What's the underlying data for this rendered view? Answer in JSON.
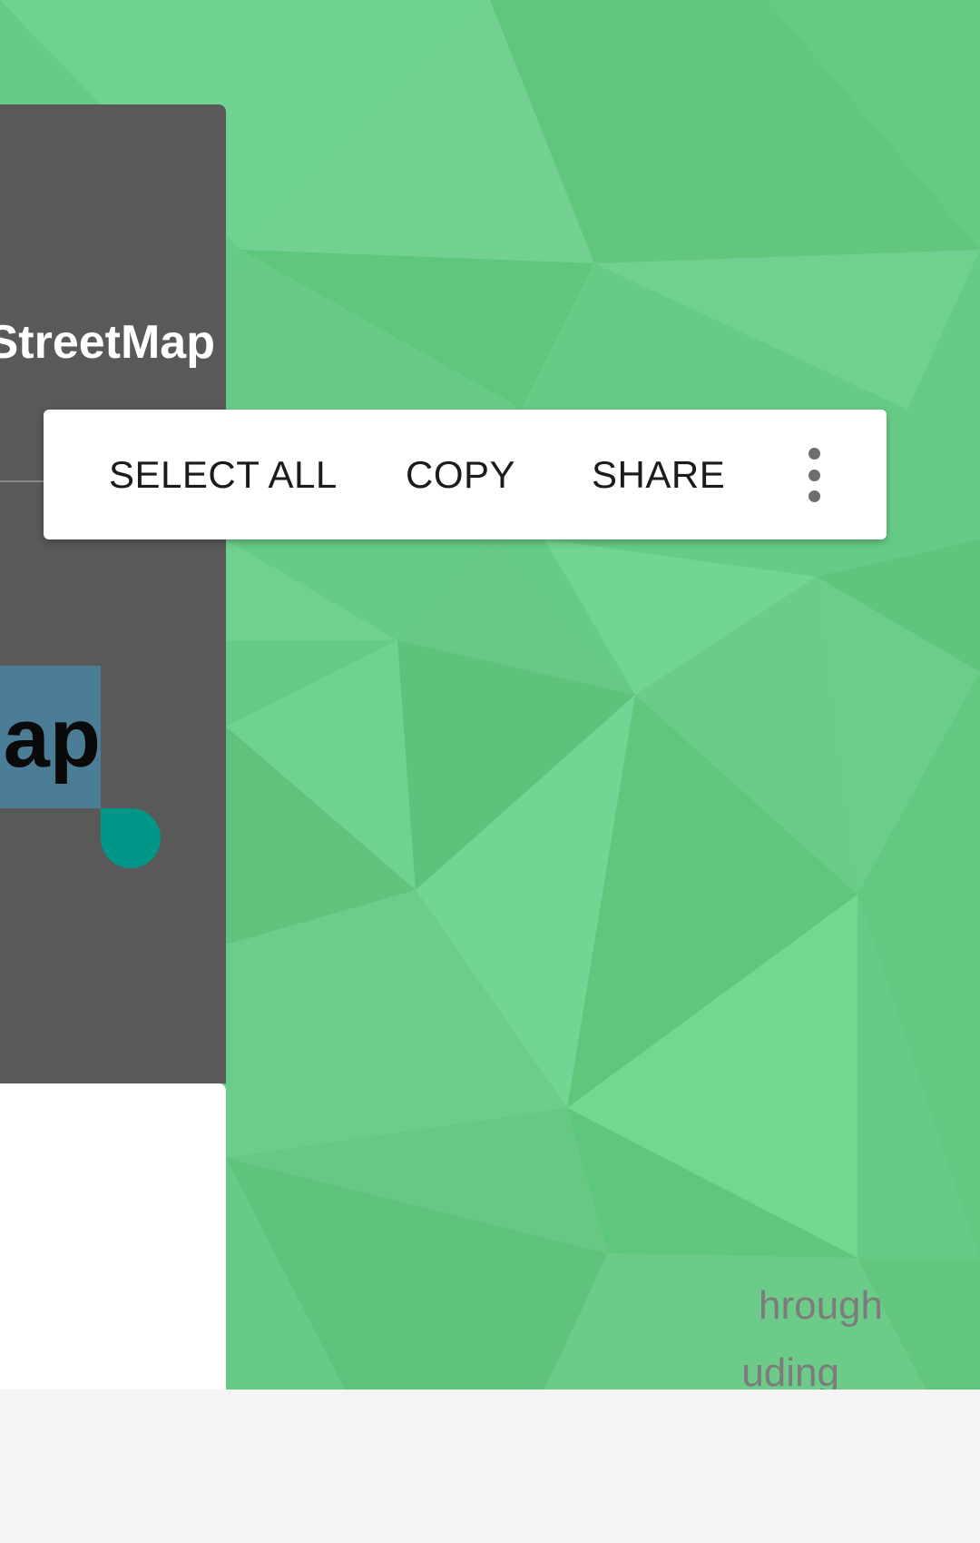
{
  "colors": {
    "background_green": "#64c880",
    "card_dark": "#595959",
    "selection_highlight": "#4b7e96",
    "selection_handle": "#009688",
    "toolbar_bg": "#ffffff"
  },
  "card": {
    "title": "StreetMap",
    "selected_text": "ap",
    "description_lines": [
      "hrough",
      "uding"
    ]
  },
  "text_selection_toolbar": {
    "select_all_label": "SELECT ALL",
    "copy_label": "COPY",
    "share_label": "SHARE",
    "more_icon": "more-vert-icon"
  }
}
